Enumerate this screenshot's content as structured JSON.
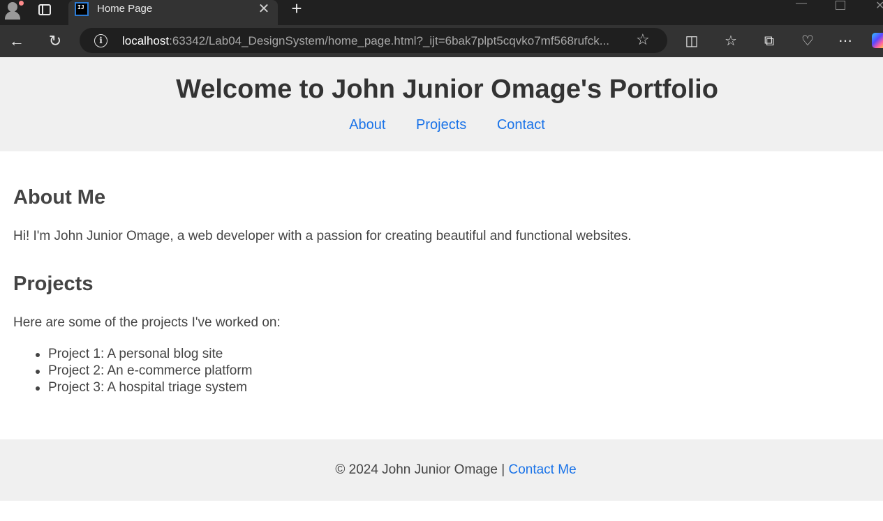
{
  "browser": {
    "tab_title": "Home Page",
    "tab_favicon_text": "IJ",
    "url_host": "localhost",
    "url_rest": ":63342/Lab04_DesignSystem/home_page.html?_ijt=6bak7plpt5cqvko7mf568rufck..."
  },
  "header": {
    "title": "Welcome to John Junior Omage's Portfolio",
    "nav": [
      "About",
      "Projects",
      "Contact"
    ]
  },
  "about": {
    "heading": "About Me",
    "text": "Hi! I'm John Junior Omage, a web developer with a passion for creating beautiful and functional websites."
  },
  "projects": {
    "heading": "Projects",
    "intro": "Here are some of the projects I've worked on:",
    "items": [
      "Project 1: A personal blog site",
      "Project 2: An e-commerce platform",
      "Project 3: A hospital triage system"
    ]
  },
  "footer": {
    "copyright": "© 2024 John Junior Omage | ",
    "link": "Contact Me"
  },
  "colors": {
    "link": "#1a73e8",
    "header_bg": "#f0f0f0",
    "text": "#444444"
  }
}
